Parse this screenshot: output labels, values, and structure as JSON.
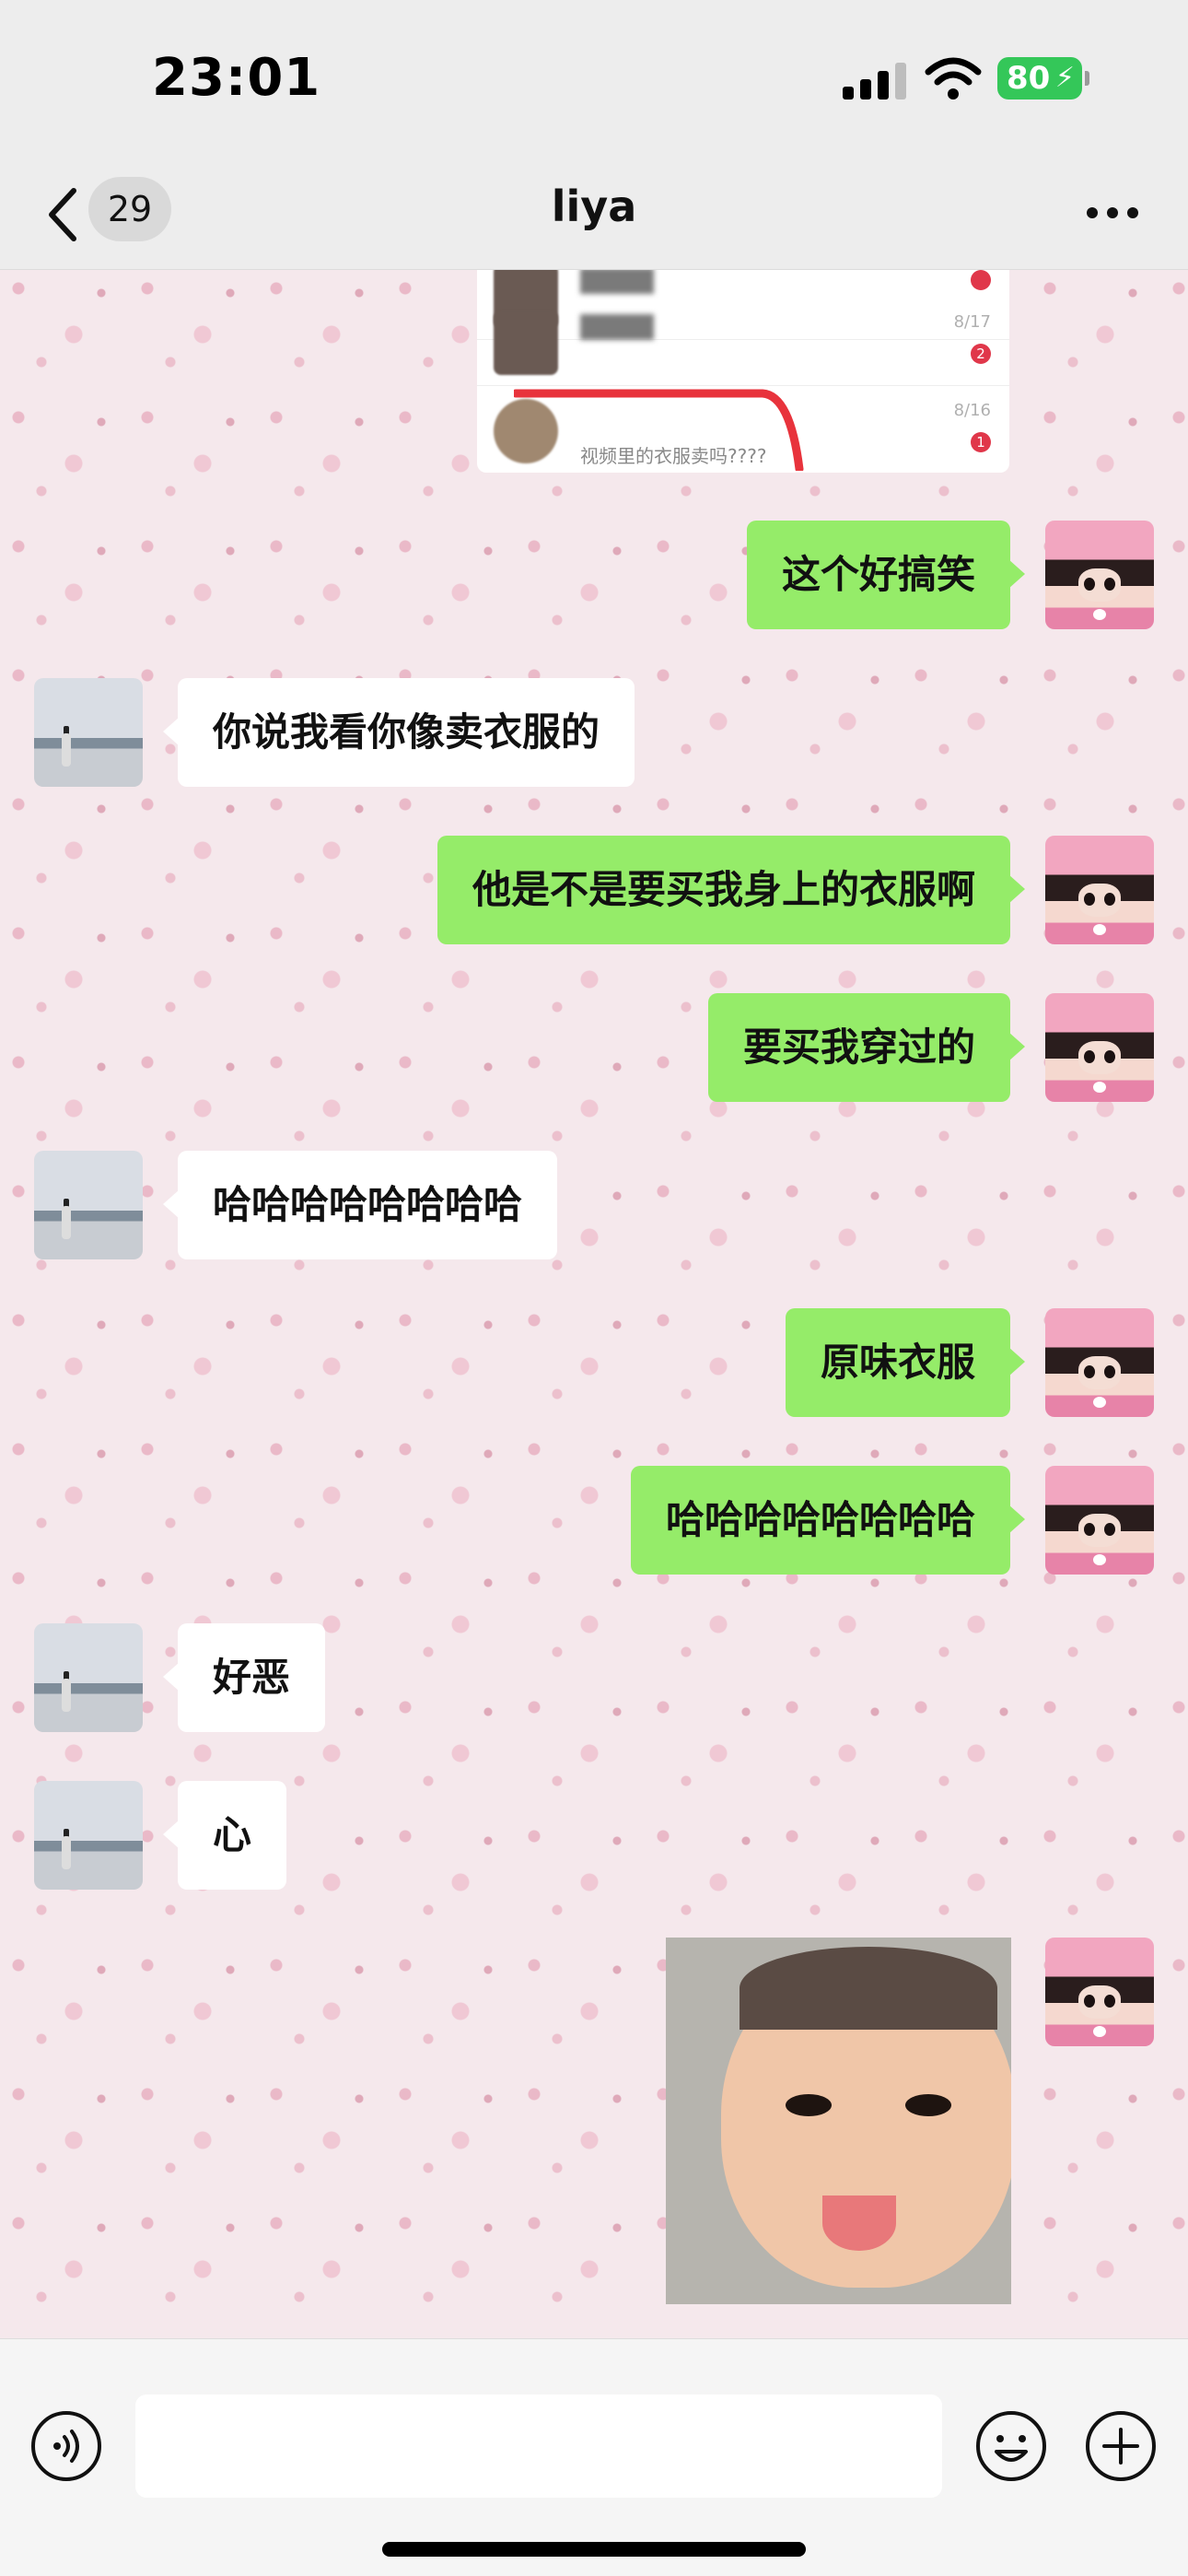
{
  "status_bar": {
    "time": "23:01",
    "battery": "80",
    "icons": [
      "signal-icon",
      "wifi-icon",
      "battery-icon"
    ]
  },
  "nav": {
    "unread_count": "29",
    "title": "liya",
    "back_icon": "chevron-left-icon",
    "more_icon": "ellipsis-icon"
  },
  "shared_card": {
    "rows": [
      {
        "date": "8/17",
        "badge": "2",
        "preview": "..."
      },
      {
        "date": "8/16",
        "badge": "1",
        "preview": "视频里的衣服卖吗????"
      }
    ]
  },
  "messages": [
    {
      "side": "mine",
      "text": "这个好搞笑"
    },
    {
      "side": "theirs",
      "text": "你说我看你像卖衣服的"
    },
    {
      "side": "mine",
      "text": "他是不是要买我身上的衣服啊"
    },
    {
      "side": "mine",
      "text": "要买我穿过的"
    },
    {
      "side": "theirs",
      "text": "哈哈哈哈哈哈哈哈"
    },
    {
      "side": "mine",
      "text": "原味衣服"
    },
    {
      "side": "mine",
      "text": "哈哈哈哈哈哈哈哈"
    },
    {
      "side": "theirs",
      "text": "好恶"
    },
    {
      "side": "theirs",
      "text": "心"
    },
    {
      "side": "mine",
      "type": "sticker"
    }
  ],
  "input_bar": {
    "placeholder": "",
    "icons": [
      "voice-icon",
      "emoji-icon",
      "plus-icon"
    ]
  },
  "colors": {
    "mine_bubble": "#95ec69",
    "theirs_bubble": "#ffffff",
    "battery": "#34c759"
  }
}
